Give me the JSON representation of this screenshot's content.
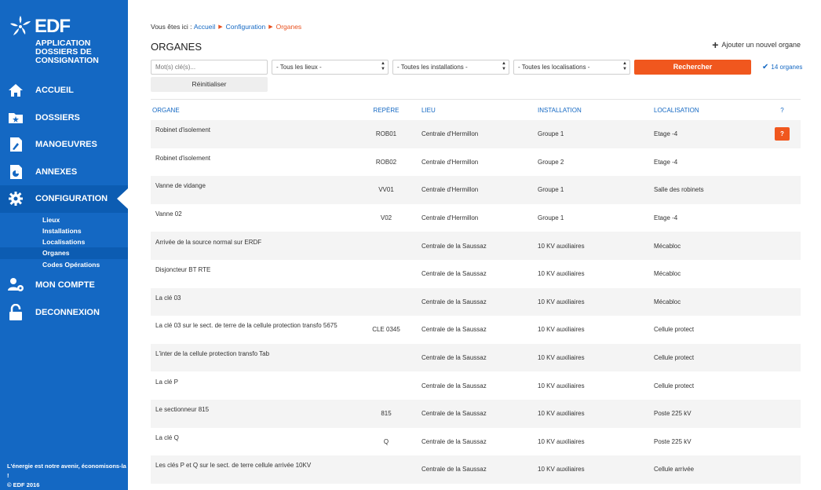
{
  "brand": {
    "logo_text": "EDF",
    "app_title_lines": [
      "APPLICATION",
      "DOSSIERS DE",
      "CONSIGNATION"
    ]
  },
  "nav": {
    "items": [
      {
        "label": "ACCUEIL",
        "icon": "home-icon"
      },
      {
        "label": "DOSSIERS",
        "icon": "folder-icon"
      },
      {
        "label": "MANOEUVRES",
        "icon": "wrench-icon"
      },
      {
        "label": "ANNEXES",
        "icon": "document-icon"
      },
      {
        "label": "CONFIGURATION",
        "icon": "gear-icon"
      },
      {
        "label": "MON COMPTE",
        "icon": "user-settings-icon"
      },
      {
        "label": "DECONNEXION",
        "icon": "unlock-icon"
      }
    ],
    "sub_items": [
      "Lieux",
      "Installations",
      "Localisations",
      "Organes",
      "Codes Opérations"
    ]
  },
  "footer": {
    "tagline": "L'énergie est notre avenir, économisons-la !",
    "copyright": "© EDF 2016"
  },
  "breadcrumb": {
    "prefix": "Vous êtes ici :",
    "items": [
      "Accueil",
      "Configuration"
    ],
    "current": "Organes"
  },
  "page": {
    "title": "ORGANES",
    "add_label": "Ajouter un nouvel organe"
  },
  "filters": {
    "keyword_placeholder": "Mot(s) clé(s)...",
    "lieux": "- Tous les lieux -",
    "installations": "- Toutes les installations -",
    "localisations": "- Toutes les localisations -",
    "search_label": "Rechercher",
    "count_label": "14 organes",
    "reset_label": "Réinitialiser"
  },
  "table": {
    "headers": [
      "ORGANE",
      "REPÈRE",
      "LIEU",
      "INSTALLATION",
      "LOCALISATION",
      "?"
    ],
    "rows": [
      {
        "organe": "Robinet d'isolement",
        "repere": "ROB01",
        "lieu": "Centrale d'Hermillon",
        "installation": "Groupe 1",
        "localisation": "Etage -4",
        "help": "?"
      },
      {
        "organe": "Robinet d'isolement",
        "repere": "ROB02",
        "lieu": "Centrale d'Hermillon",
        "installation": "Groupe 2",
        "localisation": "Etage -4",
        "help": ""
      },
      {
        "organe": "Vanne de vidange",
        "repere": "VV01",
        "lieu": "Centrale d'Hermillon",
        "installation": "Groupe 1",
        "localisation": "Salle des robinets",
        "help": ""
      },
      {
        "organe": "Vanne 02",
        "repere": "V02",
        "lieu": "Centrale d'Hermillon",
        "installation": "Groupe 1",
        "localisation": "Etage -4",
        "help": ""
      },
      {
        "organe": "Arrivée de la source normal sur ERDF",
        "repere": "",
        "lieu": "Centrale de la Saussaz",
        "installation": "10 KV auxiliaires",
        "localisation": "Mécabloc",
        "help": ""
      },
      {
        "organe": "Disjoncteur BT RTE",
        "repere": "",
        "lieu": "Centrale de la Saussaz",
        "installation": "10 KV auxiliaires",
        "localisation": "Mécabloc",
        "help": ""
      },
      {
        "organe": "La clé 03",
        "repere": "",
        "lieu": "Centrale de la Saussaz",
        "installation": "10 KV auxiliaires",
        "localisation": "Mécabloc",
        "help": ""
      },
      {
        "organe": "La clé 03 sur le sect. de terre de la cellule protection transfo 5675",
        "repere": "CLE 0345",
        "lieu": "Centrale de la Saussaz",
        "installation": "10 KV auxiliaires",
        "localisation": "Cellule protect",
        "help": ""
      },
      {
        "organe": "L'inter de la cellule protection transfo Tab",
        "repere": "",
        "lieu": "Centrale de la Saussaz",
        "installation": "10 KV auxiliaires",
        "localisation": "Cellule protect",
        "help": ""
      },
      {
        "organe": "La clé P",
        "repere": "",
        "lieu": "Centrale de la Saussaz",
        "installation": "10 KV auxiliaires",
        "localisation": "Cellule protect",
        "help": ""
      },
      {
        "organe": "Le sectionneur 815",
        "repere": "815",
        "lieu": "Centrale de la Saussaz",
        "installation": "10 KV auxiliaires",
        "localisation": "Poste 225 kV",
        "help": ""
      },
      {
        "organe": "La clé Q",
        "repere": "Q",
        "lieu": "Centrale de la Saussaz",
        "installation": "10 KV auxiliaires",
        "localisation": "Poste 225 kV",
        "help": ""
      },
      {
        "organe": "Les clés P et Q sur le sect. de terre cellule arrivée 10KV",
        "repere": "",
        "lieu": "Centrale de la Saussaz",
        "installation": "10 KV auxiliaires",
        "localisation": "Cellule arrivée",
        "help": ""
      }
    ]
  },
  "colors": {
    "sidebar": "#1468c3",
    "accent": "#f0571e",
    "link": "#1468c3"
  }
}
